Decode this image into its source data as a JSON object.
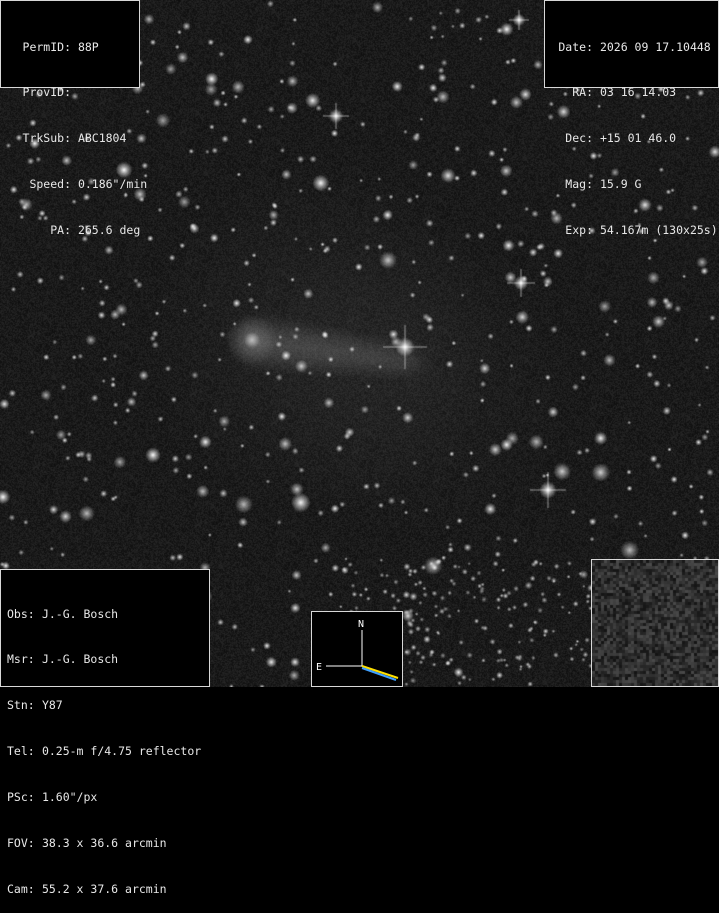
{
  "image": {
    "description_colors": {
      "sky": "#101010",
      "star": "#ffffff",
      "panel_border": "#d8d8d8",
      "panel_text": "#e8e8e8"
    }
  },
  "object_info": [
    {
      "label": "PermID:",
      "value": "88P"
    },
    {
      "label": "ProvID:",
      "value": ""
    },
    {
      "label": "TrkSub:",
      "value": "ABC1804"
    },
    {
      "label": "Speed:",
      "value": "0.186\"/min"
    },
    {
      "label": "PA:",
      "value": "265.6 deg"
    }
  ],
  "obs_info": [
    {
      "label": "Date:",
      "value": "2026 09 17.10448"
    },
    {
      "label": "RA:",
      "value": "03 16 14.03"
    },
    {
      "label": "Dec:",
      "value": "+15 01 46.0"
    },
    {
      "label": "Mag:",
      "value": "15.9 G"
    },
    {
      "label": "Exp:",
      "value": "54.167m (130x25s)"
    }
  ],
  "observer_info": [
    {
      "label": "Obs:",
      "value": "J.-G. Bosch"
    },
    {
      "label": "Msr:",
      "value": "J.-G. Bosch"
    },
    {
      "label": "Stn:",
      "value": "Y87"
    },
    {
      "label": "Tel:",
      "value": "0.25-m f/4.75 reflector"
    },
    {
      "label": "PSc:",
      "value": "1.60\"/px"
    },
    {
      "label": "FOV:",
      "value": "38.3 x 36.6 arcmin"
    },
    {
      "label": "Cam:",
      "value": "55.2 x 37.6 arcmin"
    }
  ],
  "compass": {
    "north_label": "N",
    "east_label": "E",
    "motion_colors": [
      "#ffe000",
      "#3fa0ff"
    ]
  }
}
